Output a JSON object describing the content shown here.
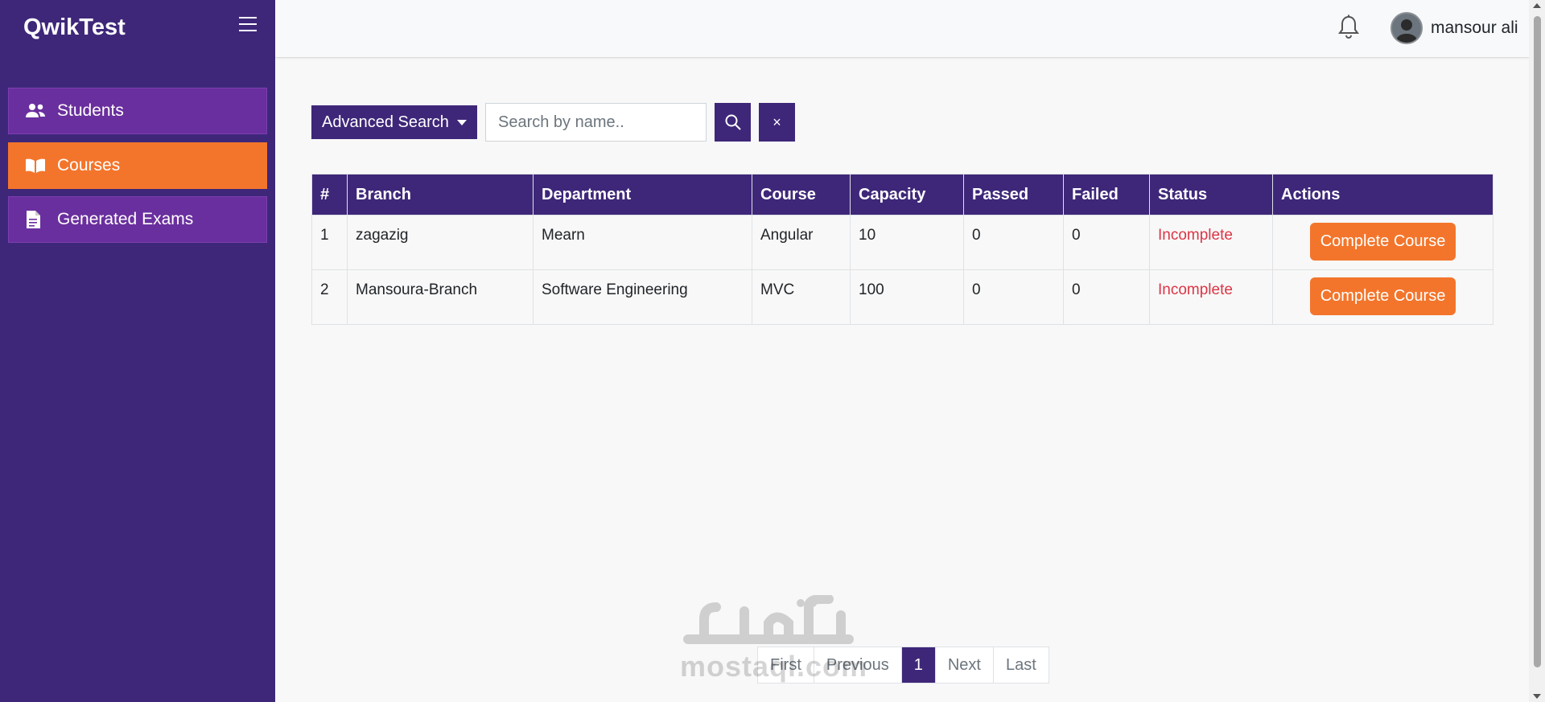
{
  "brand": "QwikTest",
  "sidebar": {
    "items": [
      {
        "label": "Students",
        "icon": "users-icon"
      },
      {
        "label": "Courses",
        "icon": "book-icon",
        "active": true
      },
      {
        "label": "Generated Exams",
        "icon": "document-icon"
      }
    ]
  },
  "header": {
    "username": "mansour ali"
  },
  "search": {
    "advanced_label": "Advanced Search",
    "placeholder": "Search by name..",
    "value": "",
    "clear_label": "×"
  },
  "table": {
    "headers": [
      "#",
      "Branch",
      "Department",
      "Course",
      "Capacity",
      "Passed",
      "Failed",
      "Status",
      "Actions"
    ],
    "rows": [
      {
        "num": "1",
        "branch": "zagazig",
        "department": "Mearn",
        "course": "Angular",
        "capacity": "10",
        "passed": "0",
        "failed": "0",
        "status": "Incomplete",
        "action": "Complete Course"
      },
      {
        "num": "2",
        "branch": "Mansoura-Branch",
        "department": "Software Engineering",
        "course": "MVC",
        "capacity": "100",
        "passed": "0",
        "failed": "0",
        "status": "Incomplete",
        "action": "Complete Course"
      }
    ]
  },
  "pagination": {
    "first": "First",
    "previous": "Previous",
    "current": "1",
    "next": "Next",
    "last": "Last"
  },
  "watermark": {
    "text": "mostaql.com"
  },
  "colors": {
    "primary": "#3e2779",
    "accent": "#f3752b",
    "danger": "#dc3545"
  }
}
